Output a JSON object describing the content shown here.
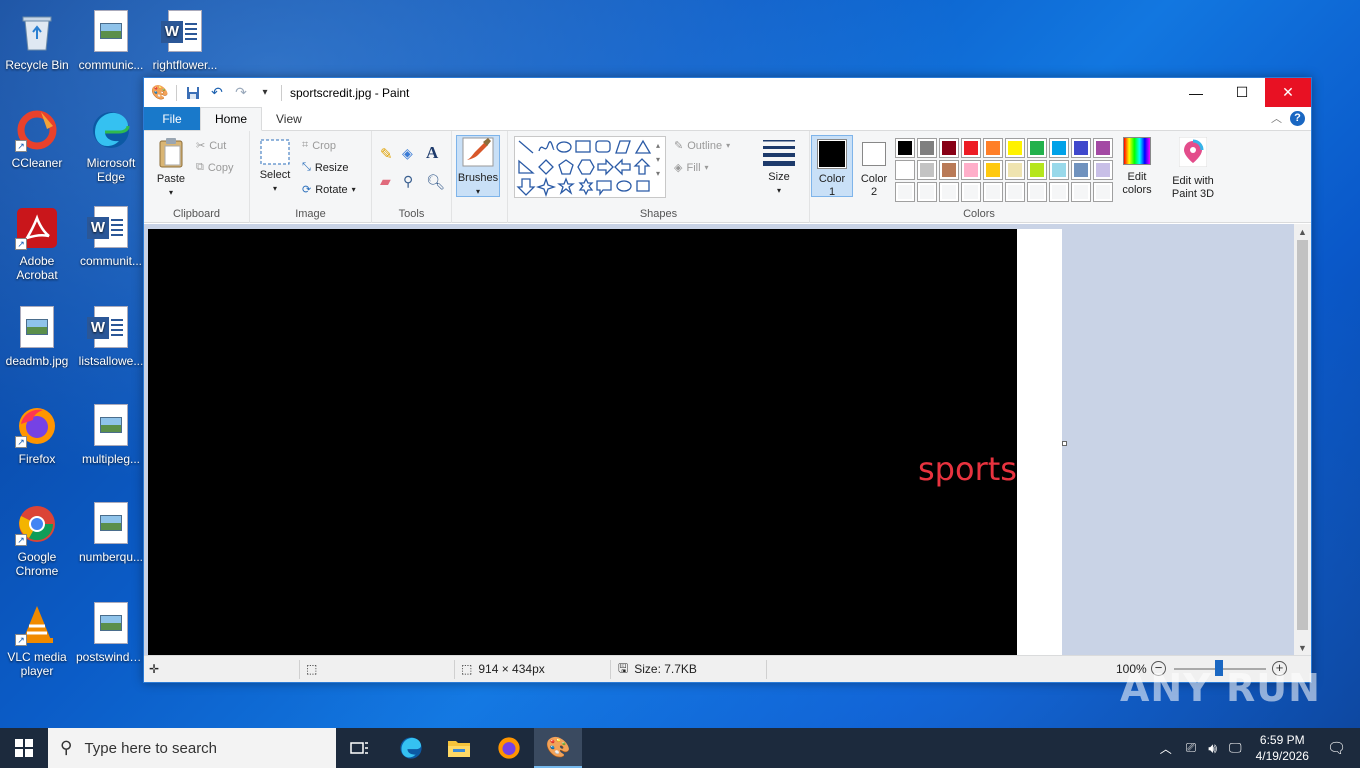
{
  "desktop": {
    "icons": [
      {
        "label": "Recycle Bin"
      },
      {
        "label": "communic..."
      },
      {
        "label": "rightflower..."
      },
      {
        "label": "CCleaner"
      },
      {
        "label": "Microsoft Edge"
      },
      {
        "label": "Adobe Acrobat"
      },
      {
        "label": "communit..."
      },
      {
        "label": "deadmb.jpg"
      },
      {
        "label": "listsallowe..."
      },
      {
        "label": "Firefox"
      },
      {
        "label": "multipleg..."
      },
      {
        "label": "Google Chrome"
      },
      {
        "label": "numberqu..."
      },
      {
        "label": "VLC media player"
      },
      {
        "label": "postswindo..."
      }
    ]
  },
  "window": {
    "title": "sportscredit.jpg - Paint"
  },
  "ribbon": {
    "tabs": {
      "file": "File",
      "home": "Home",
      "view": "View"
    },
    "clipboard": {
      "paste": "Paste",
      "cut": "Cut",
      "copy": "Copy",
      "label": "Clipboard"
    },
    "image": {
      "select": "Select",
      "crop": "Crop",
      "resize": "Resize",
      "rotate": "Rotate",
      "label": "Image"
    },
    "tools": {
      "label": "Tools"
    },
    "brushes": {
      "label": "Brushes"
    },
    "shapes": {
      "outline": "Outline",
      "fill": "Fill",
      "label": "Shapes"
    },
    "size": {
      "label": "Size"
    },
    "colors": {
      "color1": "Color 1",
      "color2": "Color 2",
      "edit": "Edit colors",
      "paint3d": "Edit with Paint 3D",
      "label": "Colors",
      "color1_value": "#000000",
      "color2_value": "#ffffff",
      "palette_row1": [
        "#000000",
        "#7f7f7f",
        "#880015",
        "#ed1c24",
        "#ff7f27",
        "#fff200",
        "#22b14c",
        "#00a2e8",
        "#3f48cc",
        "#a349a4"
      ],
      "palette_row2": [
        "#ffffff",
        "#c3c3c3",
        "#b97a57",
        "#ffaec9",
        "#ffc90e",
        "#efe4b0",
        "#b5e61d",
        "#99d9ea",
        "#7092be",
        "#c8bfe7"
      ]
    }
  },
  "canvas": {
    "text": "sports",
    "text_color": "#e8333f"
  },
  "status": {
    "dimensions": "914 × 434px",
    "size": "Size: 7.7KB",
    "zoom": "100%"
  },
  "taskbar": {
    "search_placeholder": "Type here to search",
    "time": "6:59 PM",
    "date": "4/19/2026"
  },
  "watermark": "ANY RUN"
}
